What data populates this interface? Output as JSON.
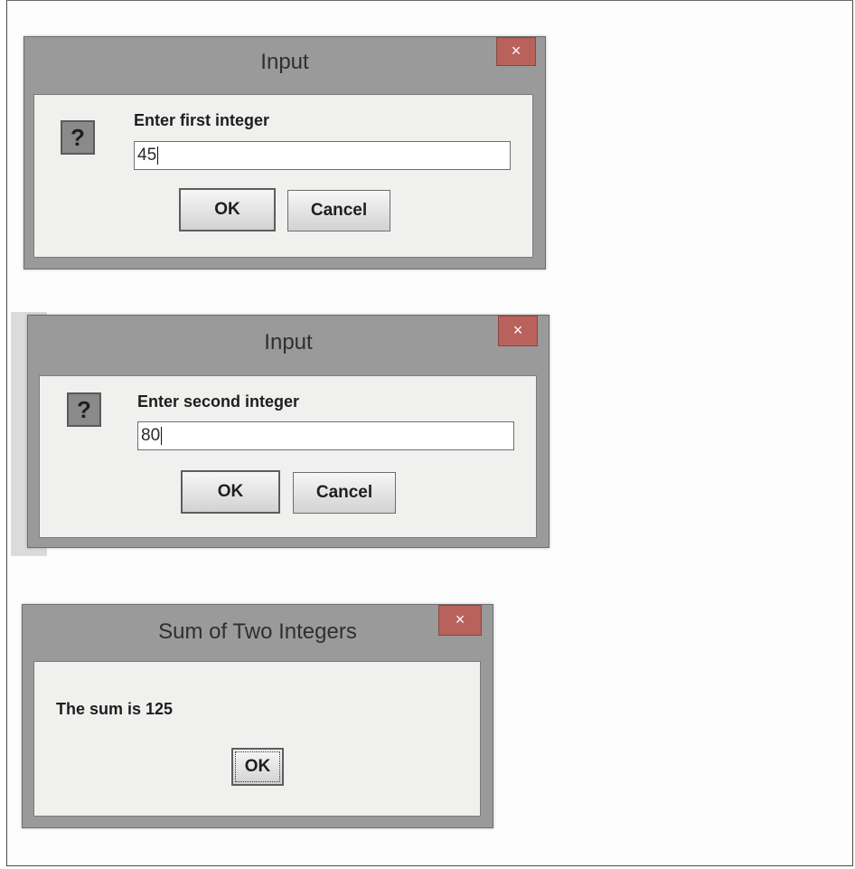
{
  "dialogs": [
    {
      "title": "Input",
      "close_glyph": "×",
      "icon": "question-icon",
      "icon_glyph": "?",
      "prompt": "Enter first integer",
      "value": "45",
      "ok_label": "OK",
      "cancel_label": "Cancel"
    },
    {
      "title": "Input",
      "close_glyph": "×",
      "icon": "question-icon",
      "icon_glyph": "?",
      "prompt": "Enter second integer",
      "value": "80",
      "ok_label": "OK",
      "cancel_label": "Cancel"
    },
    {
      "title": "Sum of Two Integers",
      "close_glyph": "×",
      "message": "The sum is 125",
      "ok_label": "OK"
    }
  ],
  "colors": {
    "dialog_frame": "#9a9a9a",
    "close_button": "#b9625b",
    "client_bg": "#f0f0ef"
  }
}
